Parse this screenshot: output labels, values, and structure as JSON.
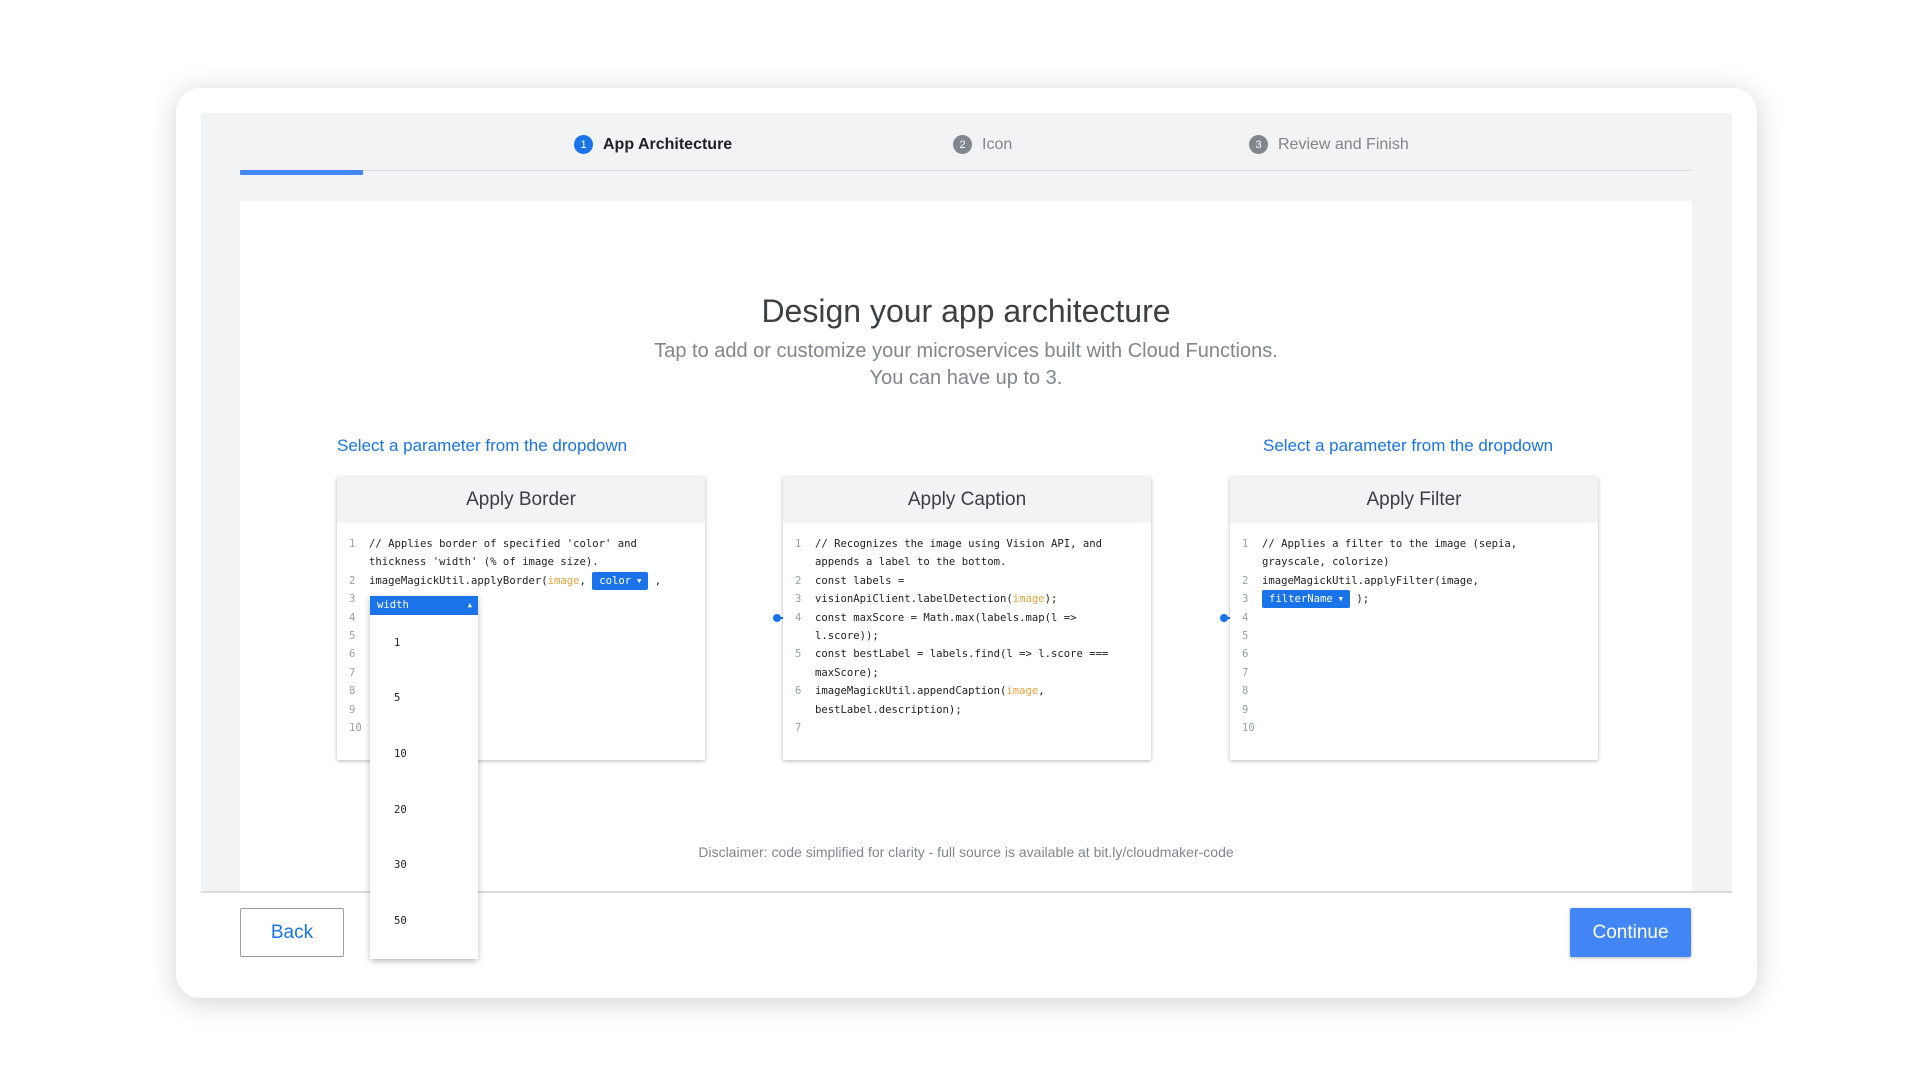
{
  "stepper": {
    "steps": [
      {
        "num": "1",
        "label": "App Architecture"
      },
      {
        "num": "2",
        "label": "Icon"
      },
      {
        "num": "3",
        "label": "Review and Finish"
      }
    ],
    "active_step": 1
  },
  "main": {
    "title": "Design your app architecture",
    "subtitle_line1": "Tap to add or customize your microservices built with Cloud Functions.",
    "subtitle_line2": "You can have up to 3.",
    "hint_left": "Select a parameter from the dropdown",
    "hint_right": "Select a parameter from the dropdown",
    "disclaimer": "Disclaimer: code simplified for clarity - full source is available at bit.ly/cloudmaker-code"
  },
  "cards": {
    "border": {
      "title": "Apply Border",
      "comment_1": "// Applies border of specified 'color' and",
      "comment_2": "thickness 'width' (% of image size).",
      "call": "imageMagickUtil.applyBorder(",
      "arg_image": "image",
      "sep": ", ",
      "chip_color": "color",
      "tail": " ,",
      "chip_width": "width"
    },
    "caption": {
      "title": "Apply Caption",
      "l1a": "// Recognizes the image using Vision API, and",
      "l1b": "appends a label to the bottom.",
      "l2": "const labels =",
      "l3a": "visionApiClient.labelDetection(",
      "l3img": "image",
      "l3b": ");",
      "l4a": "const maxScore = Math.max(labels.map(l =>",
      "l4b": "l.score));",
      "l5a": "const bestLabel = labels.find(l => l.score ===",
      "l5b": "maxScore);",
      "l6a": "imageMagickUtil.appendCaption(",
      "l6img": "image",
      "l6sep": ",",
      "l6b": "bestLabel.description);"
    },
    "filter": {
      "title": "Apply Filter",
      "comment_1": "// Applies a filter to the image (sepia,",
      "comment_2": "grayscale, colorize)",
      "call": "imageMagickUtil.applyFilter(image,",
      "chip_filter": "filterName",
      "tail": " );"
    }
  },
  "line_numbers": [
    "1",
    "2",
    "3",
    "4",
    "5",
    "6",
    "7",
    "8",
    "9",
    "10"
  ],
  "dropdown": {
    "selected": "width",
    "options": [
      "1",
      "5",
      "10",
      "20",
      "30",
      "50"
    ]
  },
  "footer": {
    "back_label": "Back",
    "continue_label": "Continue"
  },
  "colors": {
    "accent": "#1a73e8",
    "progress": "#4285f4",
    "comment": "#188038",
    "identifier": "#e8a33d"
  },
  "icons": {
    "caret_down": "▼",
    "caret_up": "▲"
  }
}
